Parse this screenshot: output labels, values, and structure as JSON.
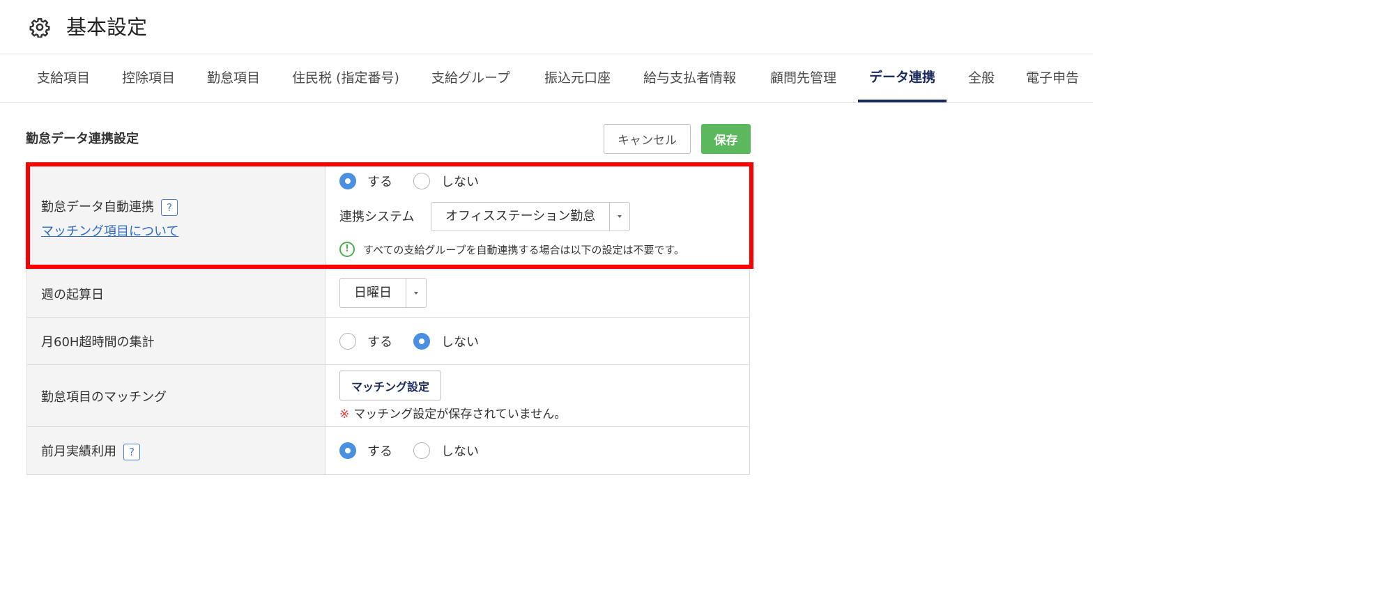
{
  "header": {
    "title": "基本設定",
    "icon": "gear-icon"
  },
  "tabs": [
    {
      "label": "支給項目",
      "active": false
    },
    {
      "label": "控除項目",
      "active": false
    },
    {
      "label": "勤怠項目",
      "active": false
    },
    {
      "label": "住民税 (指定番号)",
      "active": false
    },
    {
      "label": "支給グループ",
      "active": false
    },
    {
      "label": "振込元口座",
      "active": false
    },
    {
      "label": "給与支払者情報",
      "active": false
    },
    {
      "label": "顧問先管理",
      "active": false
    },
    {
      "label": "データ連携",
      "active": true
    },
    {
      "label": "全般",
      "active": false
    },
    {
      "label": "電子申告",
      "active": false
    }
  ],
  "section": {
    "title": "勤怠データ連携設定",
    "cancel_label": "キャンセル",
    "save_label": "保存"
  },
  "rows": {
    "auto": {
      "label": "勤怠データ自動連携",
      "help": "?",
      "link": "マッチング項目について",
      "options": [
        "する",
        "しない"
      ],
      "selected": "する",
      "system_label": "連携システム",
      "system_value": "オフィスステーション勤怠",
      "info_icon": "!",
      "info": "すべての支給グループを自動連携する場合は以下の設定は不要です。"
    },
    "week": {
      "label": "週の起算日",
      "value": "日曜日"
    },
    "overtime": {
      "label": "月60H超時間の集計",
      "options": [
        "する",
        "しない"
      ],
      "selected": "しない"
    },
    "matching": {
      "label": "勤怠項目のマッチング",
      "button": "マッチング設定",
      "warn_mark": "※",
      "warn": "マッチング設定が保存されていません。"
    },
    "prev": {
      "label": "前月実績利用",
      "help": "?",
      "options": [
        "する",
        "しない"
      ],
      "selected": "する"
    }
  },
  "colors": {
    "accent": "#1b2a5c",
    "save": "#5cb85c",
    "radio": "#4a90e2",
    "link": "#2f6cc9",
    "highlight": "#ff0000",
    "info": "#4caf50"
  }
}
